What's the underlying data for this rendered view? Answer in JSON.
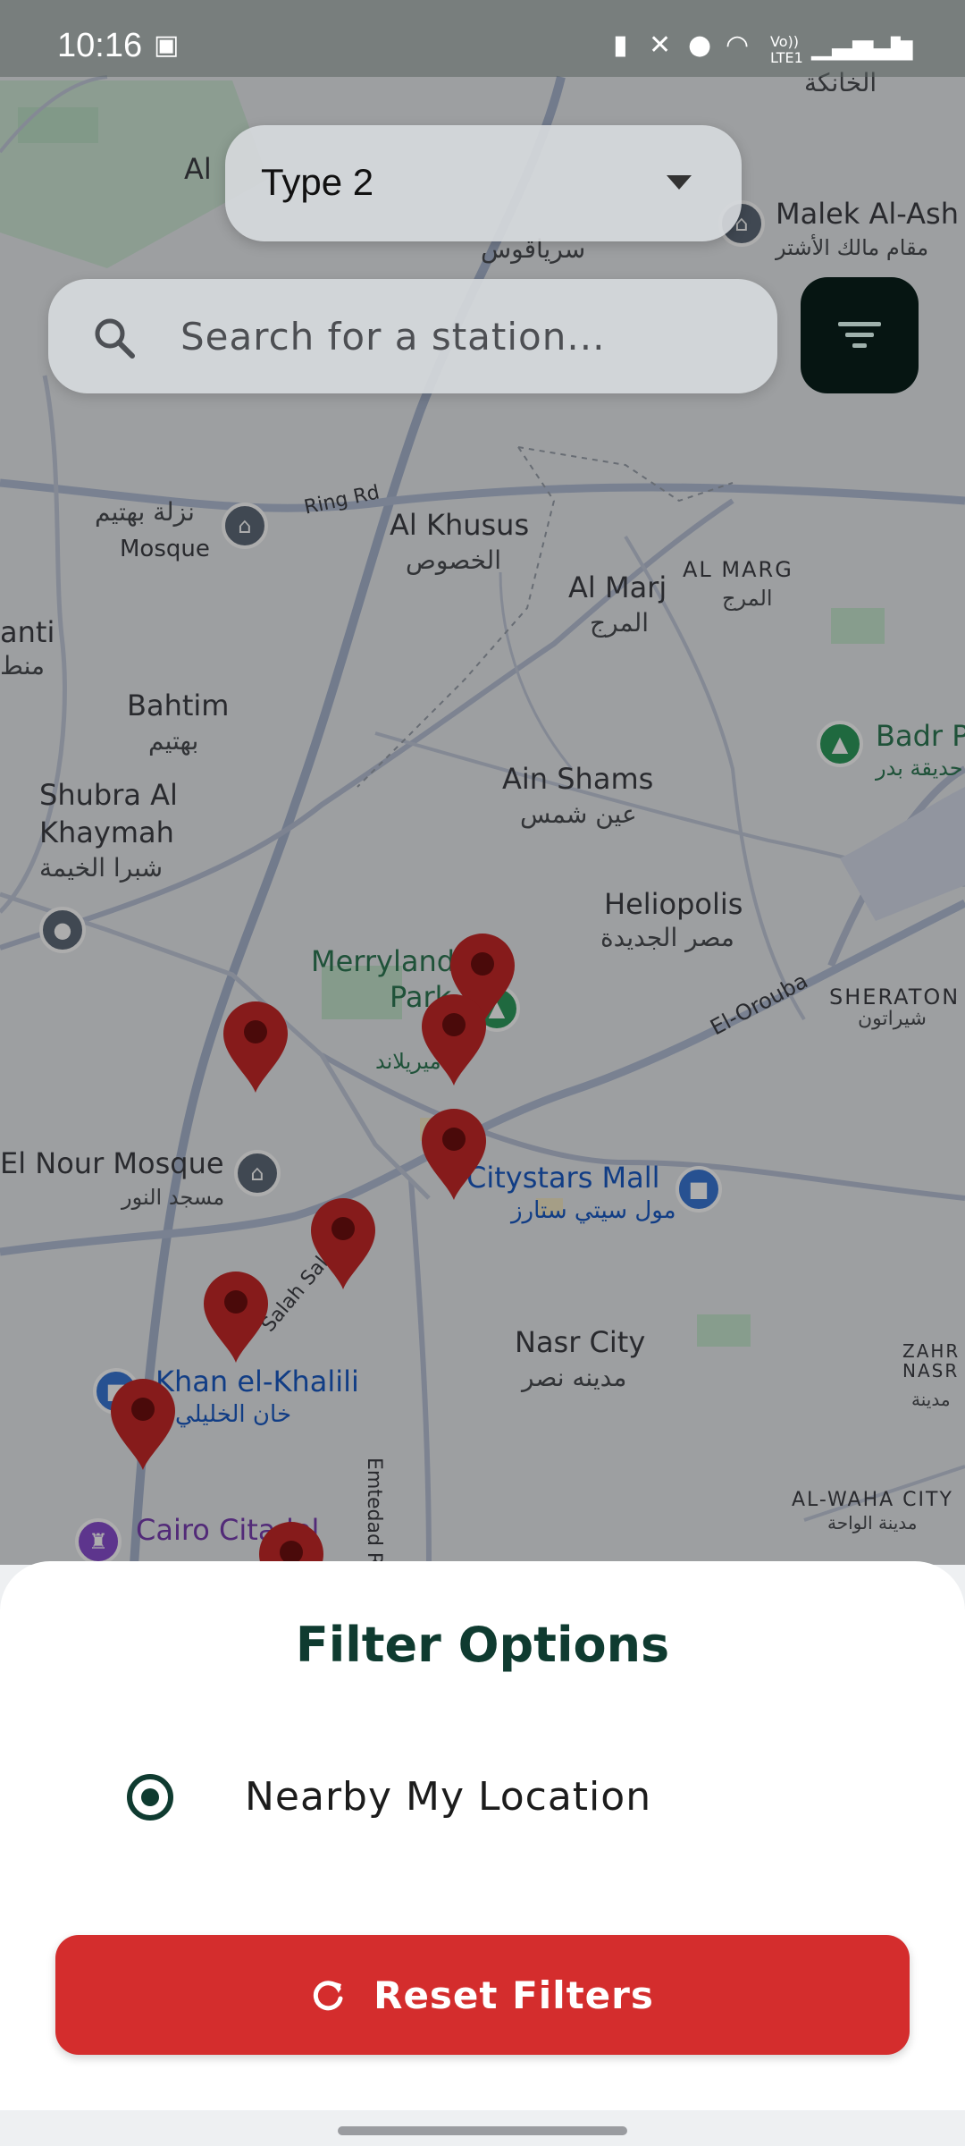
{
  "status_bar": {
    "time": "10:16",
    "icons": [
      "image-icon",
      "battery-saver-icon",
      "mute-icon",
      "location-icon",
      "wifi-icon",
      "volte-icon",
      "signal-icon",
      "signal-icon",
      "battery-icon"
    ],
    "volte_text": "Vo)) LTE1"
  },
  "type_dropdown": {
    "selected": "Type 2",
    "icon": "caret-down-icon"
  },
  "search": {
    "placeholder": "Search for a station...",
    "value": ""
  },
  "filter_button": {
    "icon": "filter-icon"
  },
  "map": {
    "labels": {
      "khanka_ar": "الخانكة",
      "al": "Al",
      "sriyakos_ar": "سرياقوس",
      "malek": "Malek Al-Ash",
      "malek_ar": "مقام مالك الأشتر",
      "nazlet_ar": "نزلة بهتيم",
      "mosque": "Mosque",
      "ring_rd": "Ring Rd",
      "khusus": "Al Khusus",
      "khusus_ar": "الخصوص",
      "al_marj": "Al Marj",
      "al_marg_caps": "AL MARG",
      "marg_ar": "المرج",
      "marg_ar2": "المرج",
      "anti": "anti",
      "anti_ar": "منط",
      "bahtim": "Bahtim",
      "bahtim_ar": "بهتيم",
      "badr": "Badr P",
      "badr_ar": "حديقة بدر",
      "ain_shams": "Ain Shams",
      "ain_shams_ar": "عين شمس",
      "shubra": "Shubra Al",
      "khaymah": "Khaymah",
      "shubra_ar": "شبرا الخيمة",
      "heliopolis": "Heliopolis",
      "heliopolis_ar": "مصر الجديدة",
      "merryland": "Merryland",
      "park": "Park",
      "merry_ar": "ميريلاند",
      "el_orouba": "El-Orouba",
      "sheraton": "SHERATON",
      "sheraton_ar": "شيراتون",
      "el_nour": "El Nour Mosque",
      "el_nour_ar": "مسجد النور",
      "citystars": "Citystars Mall",
      "citystars_ar": "مول سيتي ستارز",
      "salah_salem": "Salah Sal",
      "nasr_city": "Nasr City",
      "nasr_city_ar": "مدينه نصر",
      "zahra_nasr": "ZAHR NASR",
      "zahra_ar": "مدينة",
      "khan": "Khan el-Khalili",
      "khan_ar": "خان الخليلي",
      "emtedad": "Emtedad Ramses",
      "al_waha": "AL-WAHA CITY",
      "al_waha_ar": "مدينة الواحة",
      "cairo_citadel": "Cairo Citadel"
    },
    "marker_count": 8
  },
  "filter_sheet": {
    "title": "Filter Options",
    "option_label": "Nearby My Location",
    "option_selected": true,
    "reset_label": "Reset Filters",
    "reset_icon": "refresh-icon"
  },
  "colors": {
    "accent_dark": "#0f3b30",
    "reset_red": "#d42d2d",
    "marker_red": "#c62828",
    "filter_button_bg": "#061512"
  }
}
